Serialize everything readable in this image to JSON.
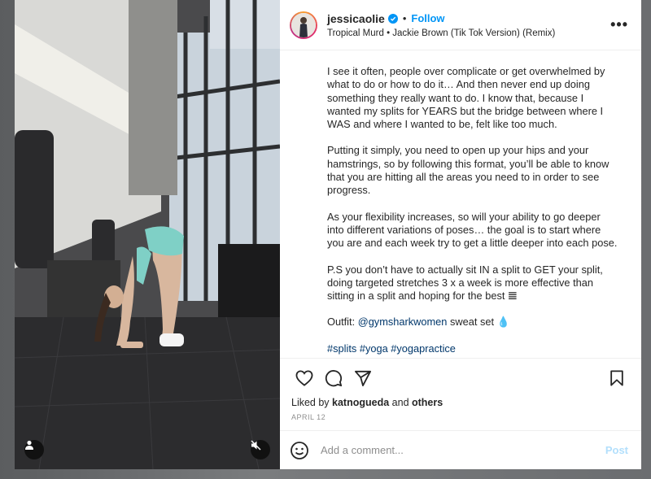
{
  "post": {
    "username": "jessicaolie",
    "follow_label": "Follow",
    "separator": "•",
    "audio": "Tropical Murd • Jackie Brown (Tik Tok Version) (Remix)",
    "more_label": "•••"
  },
  "caption": {
    "paragraphs": [
      "I see it often, people over complicate or get overwhelmed by what to do or how to do it… And then never end up doing something they really want to do. I know that, because I wanted my splits for YEARS but the bridge between where I WAS and where I wanted to be, felt like too much.",
      "Putting it simply, you need to open up your hips and your hamstrings, so by following this format, you’ll be able to know that you are hitting all the areas you need to in order to see progress.",
      "As your flexibility increases, so will your ability to go deeper into different variations of poses… the goal is to start where you are and each week try to get a little deeper into each pose.",
      "P.S you don’t have to actually sit IN a split to GET your split, doing targeted stretches 3 x a week is more effective than sitting in a split and hoping for the best 𝌆"
    ],
    "outfit_prefix": "Outfit: ",
    "outfit_mention": "@gymsharkwomen",
    "outfit_suffix": " sweat set 💧",
    "hashtags": "#splits #yoga #yogapractice"
  },
  "engagement": {
    "liked_by_prefix": "Liked by ",
    "liked_by_user": "katnogueda",
    "liked_by_and": " and ",
    "liked_by_others": "others",
    "date": "APRIL 12"
  },
  "comment_box": {
    "placeholder": "Add a comment...",
    "post_label": "Post"
  },
  "icons": {
    "like": "heart-icon",
    "comment": "comment-icon",
    "share": "send-icon",
    "save": "bookmark-icon",
    "emoji": "emoji-icon",
    "user_tag": "user-icon",
    "mute": "muted-speaker-icon",
    "verified": "verified-badge-icon"
  },
  "colors": {
    "accent": "#0095f6",
    "post_disabled": "#b2dffc",
    "link": "#00376b"
  }
}
